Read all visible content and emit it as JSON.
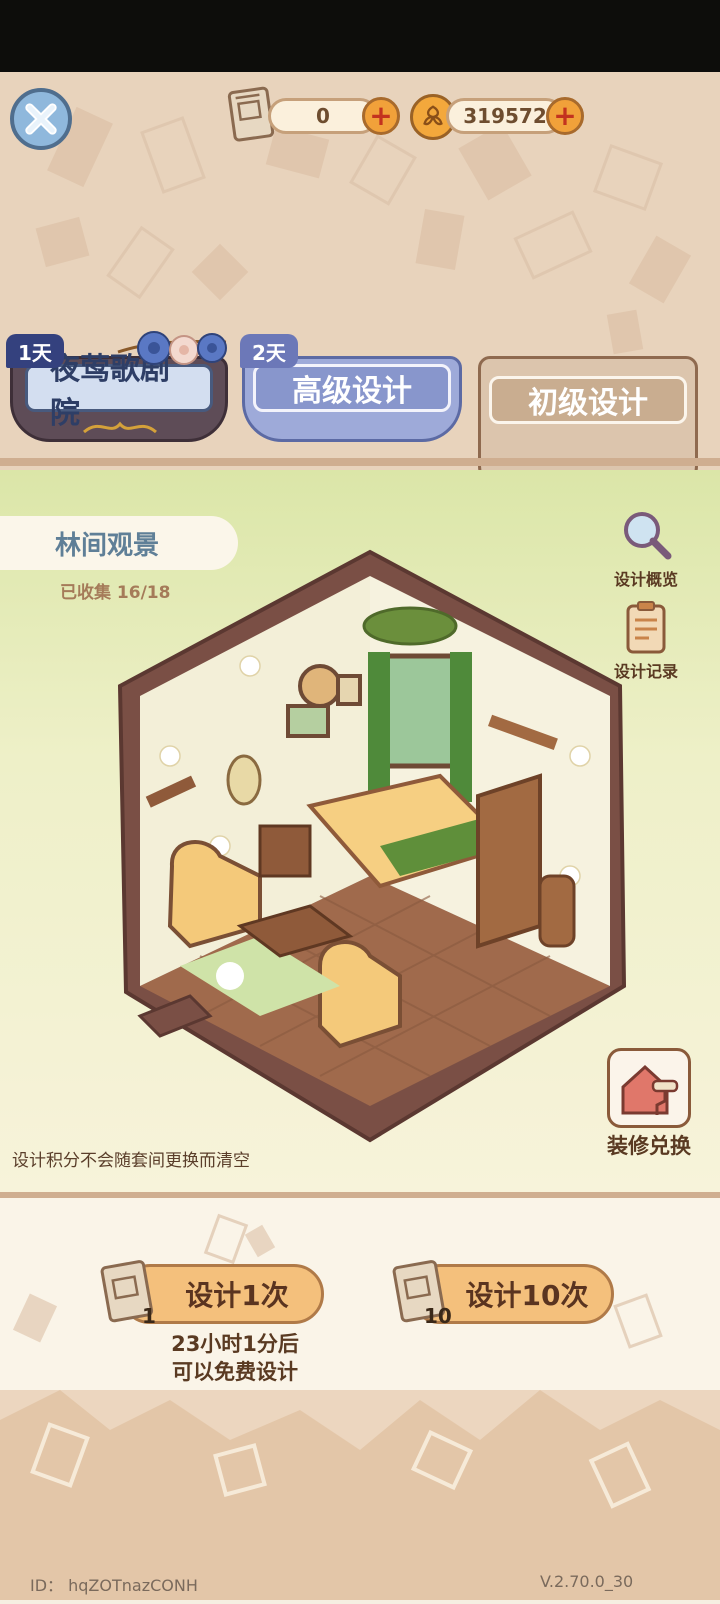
{
  "header": {
    "scroll_count": "0",
    "coin_count": "319572"
  },
  "tabs": [
    {
      "badge": "1天",
      "label": "夜莺歌剧院"
    },
    {
      "badge": "2天",
      "label": "高级设计"
    },
    {
      "label": "初级设计"
    }
  ],
  "suite": {
    "title": "林间观景",
    "collected": "已收集 16/18"
  },
  "side_buttons": {
    "overview": "设计概览",
    "records": "设计记录",
    "redeem": "装修兑换"
  },
  "notice": "设计积分不会随套间更换而清空",
  "design": {
    "once_label": "设计1次",
    "once_cost": "1",
    "ten_label": "设计10次",
    "ten_cost": "10",
    "free_note_line1": "23小时1分后",
    "free_note_line2": "可以免费设计"
  },
  "footer": {
    "user_id": "ID： hqZOTnazCONH",
    "version": "V.2.70.0_30"
  },
  "colors": {
    "accent_orange": "#f4c07c",
    "blue_tab": "#7c90c8",
    "room_frame": "#7a4f45"
  }
}
